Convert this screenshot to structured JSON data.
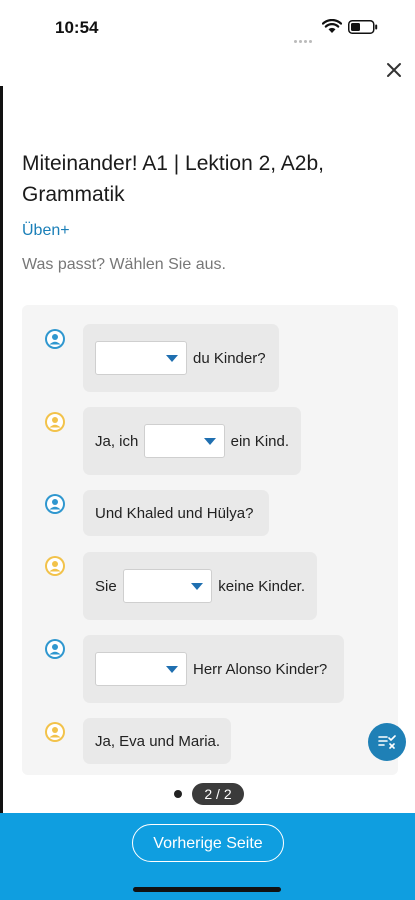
{
  "status": {
    "time": "10:54"
  },
  "header": {
    "title": "Miteinander! A1 | Lektion 2, A2b, Grammatik",
    "uben_link": "Üben+",
    "instruction": "Was passt? Wählen Sie aus."
  },
  "chat": {
    "messages": [
      {
        "avatar_color": "#2f97cf",
        "before": "",
        "has_dropdown": true,
        "after": "du Kinder?"
      },
      {
        "avatar_color": "#f2c24a",
        "before": "Ja, ich",
        "has_dropdown": true,
        "after": "ein Kind."
      },
      {
        "avatar_color": "#2f97cf",
        "before": "Und Khaled und Hülya?",
        "has_dropdown": false,
        "after": ""
      },
      {
        "avatar_color": "#f2c24a",
        "before": "Sie",
        "has_dropdown": true,
        "after": "keine Kinder."
      },
      {
        "avatar_color": "#2f97cf",
        "before": "",
        "has_dropdown": true,
        "after": "Herr Alonso Kinder?"
      },
      {
        "avatar_color": "#f2c24a",
        "before": "Ja, Eva und Maria.",
        "has_dropdown": false,
        "after": ""
      }
    ]
  },
  "pager": {
    "label": "2 / 2"
  },
  "footer": {
    "prev_button": "Vorherige Seite"
  },
  "colors": {
    "accent": "#0f9ee0",
    "link": "#1a7fb8",
    "fab": "#1f80b6",
    "dropdown_arrow": "#1f6fb0"
  },
  "icons": {
    "close": "close-icon",
    "avatar": "user-avatar-icon",
    "dropdown": "caret-down-icon",
    "fab": "checklist-icon"
  }
}
